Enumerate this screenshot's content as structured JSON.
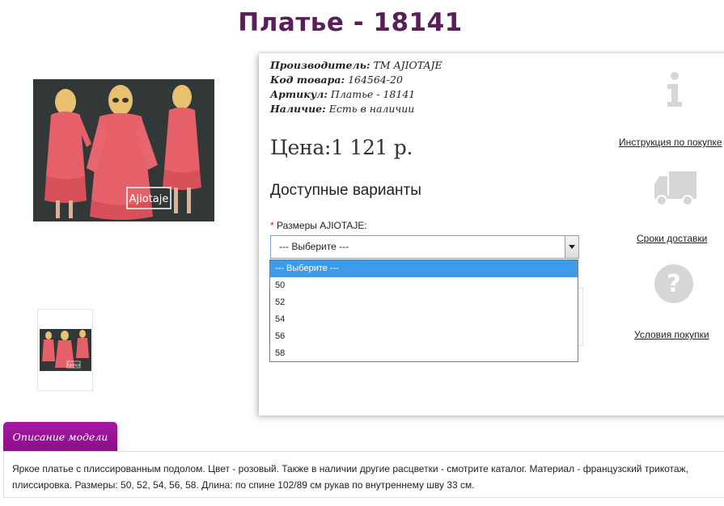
{
  "product": {
    "title": "Платье - 18141",
    "photo_logo": "Ajiotaje",
    "thumb_logo": "Ajiotaje"
  },
  "specs": [
    {
      "label": "Производитель:",
      "value": "ТМ AJIOTAJE"
    },
    {
      "label": "Код товара:",
      "value": "164564-20"
    },
    {
      "label": "Артикул:",
      "value": "Платье - 18141"
    },
    {
      "label": "Наличие:",
      "value": "Есть в наличии"
    }
  ],
  "price": "Цена:1 121 р.",
  "variants_title": "Доступные варианты",
  "size_select": {
    "required_mark": "*",
    "label": "Размеры AJIOTAJE:",
    "current": "--- Выберите ---",
    "options": [
      "--- Выберите ---",
      "50",
      "52",
      "54",
      "56",
      "58"
    ]
  },
  "side_links": {
    "instruction": "Инструкция по покупке",
    "delivery": "Сроки доставки",
    "terms": "Условия покупки"
  },
  "description": {
    "tab_label": "Описание модели",
    "text": "Яркое платье с плиссированным подолом. Цвет - розовый. Также в наличии другие расцветки - смотрите каталог. Материал - французский трикотаж, плиссировка. Размеры: 50, 52, 54, 56, 58. Длина: по спине 102/89 см рукав по внутреннему шву 33 см."
  },
  "colors": {
    "title": "#5a1f5a",
    "tab": "#9a149a",
    "dropdown_highlight": "#3d9be9",
    "icons": "#d6d6d6",
    "dress": "#e6606a"
  },
  "icons": {
    "info": "info-icon",
    "delivery": "truck-icon",
    "terms": "question-icon"
  }
}
